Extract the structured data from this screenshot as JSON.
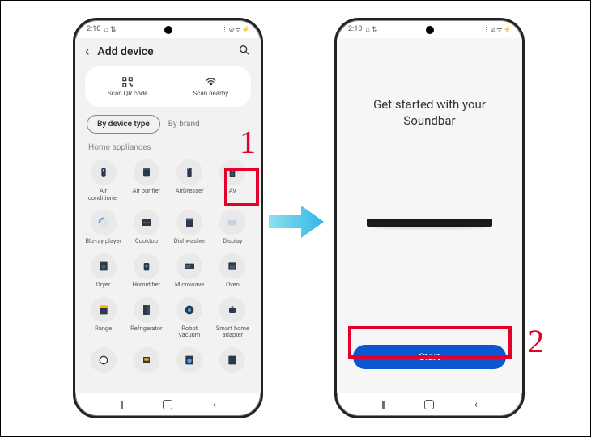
{
  "status": {
    "time": "2:10",
    "indicators_left": "⌂ ⇅",
    "indicators_right": "⋮ ⊘ ᯤ ⚡"
  },
  "left": {
    "header": {
      "title": "Add device"
    },
    "scan": {
      "qr": "Scan QR code",
      "nearby": "Scan nearby"
    },
    "filter": {
      "by_type": "By device type",
      "by_brand": "By brand"
    },
    "section": "Home appliances",
    "devices": [
      {
        "label": "Air conditioner"
      },
      {
        "label": "Air purifier"
      },
      {
        "label": "AirDresser"
      },
      {
        "label": "AV"
      },
      {
        "label": "Blu-ray player"
      },
      {
        "label": "Cooktop"
      },
      {
        "label": "Dishwasher"
      },
      {
        "label": "Display"
      },
      {
        "label": "Dryer"
      },
      {
        "label": "Humidifier"
      },
      {
        "label": "Microwave"
      },
      {
        "label": "Oven"
      },
      {
        "label": "Range"
      },
      {
        "label": "Refrigerator"
      },
      {
        "label": "Robot vacuum"
      },
      {
        "label": "Smart home adapter"
      },
      {
        "label": ""
      },
      {
        "label": ""
      },
      {
        "label": ""
      },
      {
        "label": ""
      }
    ]
  },
  "right": {
    "title_line1": "Get started with your",
    "title_line2": "Soundbar",
    "start": "Start"
  },
  "steps": {
    "one": "1",
    "two": "2"
  }
}
